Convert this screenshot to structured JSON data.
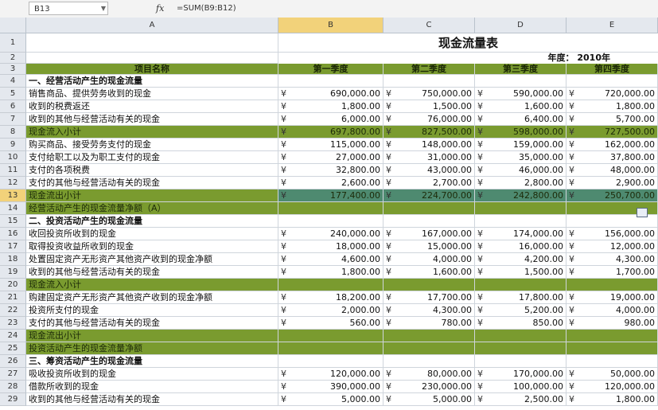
{
  "formula_bar": {
    "name_box": "B13",
    "formula": "=SUM(B9:B12)"
  },
  "columns": [
    "A",
    "B",
    "C",
    "D",
    "E"
  ],
  "selected_column": "B",
  "title": "现金流量表",
  "year_label": "年度： 2010年",
  "header_row": [
    "项目名称",
    "第一季度",
    "第二季度",
    "第三季度",
    "第四季度"
  ],
  "rows": [
    {
      "n": "4",
      "label": "一、经营活动产生的现金流量",
      "style": "section",
      "vals": []
    },
    {
      "n": "5",
      "label": "销售商品、提供劳务收到的现金",
      "vals": [
        "690,000.00",
        "750,000.00",
        "590,000.00",
        "720,000.00"
      ]
    },
    {
      "n": "6",
      "label": "收到的税费返还",
      "vals": [
        "1,800.00",
        "1,500.00",
        "1,600.00",
        "1,800.00"
      ]
    },
    {
      "n": "7",
      "label": "收到的其他与经营活动有关的现金",
      "vals": [
        "6,000.00",
        "76,000.00",
        "6,400.00",
        "5,700.00"
      ]
    },
    {
      "n": "8",
      "label": "现金流入小计",
      "style": "green",
      "vals": [
        "697,800.00",
        "827,500.00",
        "598,000.00",
        "727,500.00"
      ]
    },
    {
      "n": "9",
      "label": "购买商品、接受劳务支付的现金",
      "vals": [
        "115,000.00",
        "148,000.00",
        "159,000.00",
        "162,000.00"
      ]
    },
    {
      "n": "10",
      "label": "支付给职工以及为职工支付的现金",
      "vals": [
        "27,000.00",
        "31,000.00",
        "35,000.00",
        "37,800.00"
      ]
    },
    {
      "n": "11",
      "label": "支付的各项税费",
      "vals": [
        "32,800.00",
        "43,000.00",
        "46,000.00",
        "48,000.00"
      ]
    },
    {
      "n": "12",
      "label": "支付的其他与经营活动有关的现金",
      "vals": [
        "2,600.00",
        "2,700.00",
        "2,800.00",
        "2,900.00"
      ]
    },
    {
      "n": "13",
      "label": "现金流出小计",
      "style": "green",
      "selected": true,
      "vals": [
        "177,400.00",
        "224,700.00",
        "242,800.00",
        "250,700.00"
      ]
    },
    {
      "n": "14",
      "label": "经营活动产生的现金流量净额（A）",
      "style": "green",
      "vals": []
    },
    {
      "n": "15",
      "label": "二、投资活动产生的现金流量",
      "style": "section",
      "vals": []
    },
    {
      "n": "16",
      "label": "收回投资所收到的现金",
      "vals": [
        "240,000.00",
        "167,000.00",
        "174,000.00",
        "156,000.00"
      ]
    },
    {
      "n": "17",
      "label": "取得投资收益所收到的现金",
      "vals": [
        "18,000.00",
        "15,000.00",
        "16,000.00",
        "12,000.00"
      ]
    },
    {
      "n": "18",
      "label": "处置固定资产无形资产其他资产收到的现金净额",
      "vals": [
        "4,600.00",
        "4,000.00",
        "4,200.00",
        "4,300.00"
      ]
    },
    {
      "n": "19",
      "label": "收到的其他与经营活动有关的现金",
      "vals": [
        "1,800.00",
        "1,600.00",
        "1,500.00",
        "1,700.00"
      ]
    },
    {
      "n": "20",
      "label": "现金流入小计",
      "style": "green",
      "vals": []
    },
    {
      "n": "21",
      "label": "购建固定资产无形资产其他资产收到的现金净额",
      "vals": [
        "18,200.00",
        "17,700.00",
        "17,800.00",
        "19,000.00"
      ]
    },
    {
      "n": "22",
      "label": "投资所支付的现金",
      "vals": [
        "2,000.00",
        "4,300.00",
        "5,200.00",
        "4,000.00"
      ]
    },
    {
      "n": "23",
      "label": "支付的其他与经营活动有关的现金",
      "vals": [
        "560.00",
        "780.00",
        "850.00",
        "980.00"
      ]
    },
    {
      "n": "24",
      "label": "现金流出小计",
      "style": "green",
      "vals": []
    },
    {
      "n": "25",
      "label": "投资活动产生的现金流量净额",
      "style": "green",
      "vals": []
    },
    {
      "n": "26",
      "label": "三、筹资活动产生的现金流量",
      "style": "section",
      "vals": []
    },
    {
      "n": "27",
      "label": "吸收投资所收到的现金",
      "vals": [
        "120,000.00",
        "80,000.00",
        "170,000.00",
        "50,000.00"
      ]
    },
    {
      "n": "28",
      "label": "借款所收到的现金",
      "vals": [
        "390,000.00",
        "230,000.00",
        "100,000.00",
        "120,000.00"
      ]
    },
    {
      "n": "29",
      "label": "收到的其他与经营活动有关的现金",
      "vals": [
        "5,000.00",
        "5,000.00",
        "2,500.00",
        "1,800.00"
      ]
    }
  ],
  "currency_symbol": "¥",
  "colors": {
    "green": "#7a9b2f",
    "selection": "#4e8a70",
    "header_bg": "#e4e8ee"
  }
}
